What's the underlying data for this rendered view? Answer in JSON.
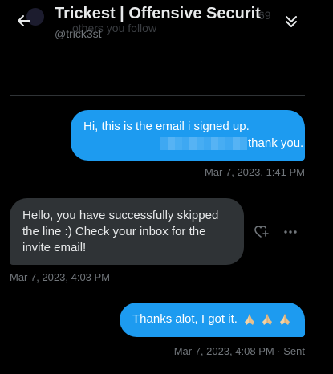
{
  "header": {
    "title": "Trickest | Offensive Securit",
    "handle": "@trick3st",
    "ghost_follow_text": "others you follow",
    "ghost_count_text": "69"
  },
  "messages": [
    {
      "direction": "outgoing",
      "line1": "Hi, this is the email i signed up.",
      "line2_suffix": "thank you.",
      "timestamp": "Mar 7, 2023, 1:41 PM"
    },
    {
      "direction": "incoming",
      "text": "Hello, you have successfully skipped\nthe line :) Check your inbox for the\ninvite email!",
      "timestamp": "Mar 7, 2023, 4:03 PM"
    },
    {
      "direction": "outgoing",
      "text": "Thanks alot, I got it.",
      "emoji_count": 3,
      "emoji_name": "folded-hands",
      "timestamp": "Mar 7, 2023, 4:08 PM · Sent"
    }
  ],
  "colors": {
    "background": "#000000",
    "outgoing_bubble": "#1d9bf0",
    "incoming_bubble": "#2f3336",
    "secondary_text": "#71767b",
    "primary_text": "#e7e9ea"
  },
  "icons": {
    "back": "arrow-left-icon",
    "collapse": "chevrons-down-icon",
    "react": "heart-plus-icon",
    "more": "more-horizontal-icon"
  }
}
